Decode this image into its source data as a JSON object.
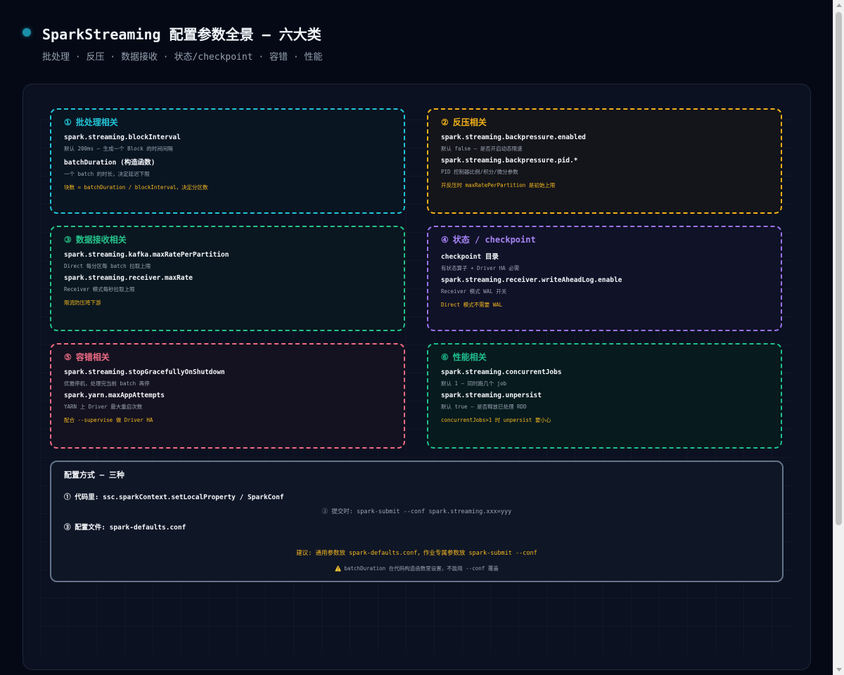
{
  "header": {
    "title": "SparkStreaming 配置参数全景 — 六大类",
    "subtitle": "批处理 · 反压 · 数据接收 · 状态/checkpoint · 容错 · 性能"
  },
  "cards": [
    {
      "num": "①",
      "title": "批处理相关",
      "color": "#22c5d8",
      "items": [
        {
          "param": "spark.streaming.blockInterval",
          "desc": "默认 200ms — 生成一个 Block 的时间间隔"
        },
        {
          "param": "batchDuration (构造函数)",
          "desc": "一个 batch 的时长，决定延迟下限"
        }
      ],
      "note": "块数 = batchDuration / blockInterval，决定分区数"
    },
    {
      "num": "②",
      "title": "反压相关",
      "color": "#f2b11a",
      "items": [
        {
          "param": "spark.streaming.backpressure.enabled",
          "desc": "默认 false — 是否开启动态限速"
        },
        {
          "param": "spark.streaming.backpressure.pid.*",
          "desc": "PID 控制器比例/积分/微分参数"
        }
      ],
      "note": "开反压时 maxRatePerPartition 是初始上限"
    },
    {
      "num": "③",
      "title": "数据接收相关",
      "color": "#25c38a",
      "items": [
        {
          "param": "spark.streaming.kafka.maxRatePerPartition",
          "desc": "Direct 每分区每 batch 拉取上限"
        },
        {
          "param": "spark.streaming.receiver.maxRate",
          "desc": "Receiver 模式每秒拉取上限"
        }
      ],
      "note": "限流防压垮下游"
    },
    {
      "num": "④",
      "title": "状态 / checkpoint",
      "color": "#a784f5",
      "items": [
        {
          "param": "checkpoint 目录",
          "desc": "有状态算子 + Driver HA 必需"
        },
        {
          "param": "spark.streaming.receiver.writeAheadLog.enable",
          "desc": "Receiver 模式 WAL 开关"
        }
      ],
      "note": "Direct 模式不需要 WAL"
    },
    {
      "num": "⑤",
      "title": "容错相关",
      "color": "#f06b85",
      "items": [
        {
          "param": "spark.streaming.stopGracefullyOnShutdown",
          "desc": "优雅停机，处理完当前 batch 再停"
        },
        {
          "param": "spark.yarn.maxAppAttempts",
          "desc": "YARN 上 Driver 最大重启次数"
        }
      ],
      "note": "配合 --supervise 做 Driver HA"
    },
    {
      "num": "⑥",
      "title": "性能相关",
      "color": "#1fbf8c",
      "items": [
        {
          "param": "spark.streaming.concurrentJobs",
          "desc": "默认 1 — 同时跑几个 job"
        },
        {
          "param": "spark.streaming.unpersist",
          "desc": "默认 true — 是否释放已处理 RDD"
        }
      ],
      "note": "concurrentJobs>1 时 unpersist 要小心"
    }
  ],
  "config": {
    "title": "配置方式 — 三种",
    "line1": "① 代码里: ssc.sparkContext.setLocalProperty / SparkConf",
    "line2": "② 提交时: spark-submit --conf spark.streaming.xxx=yyy",
    "line3": "③ 配置文件: spark-defaults.conf",
    "advice": "建议: 通用参数放 spark-defaults.conf，作业专属参数放 spark-submit --conf",
    "warning_icon": "⚠️",
    "warning": "batchDuration 在代码构造函数里设置，不能用 --conf 覆盖"
  }
}
